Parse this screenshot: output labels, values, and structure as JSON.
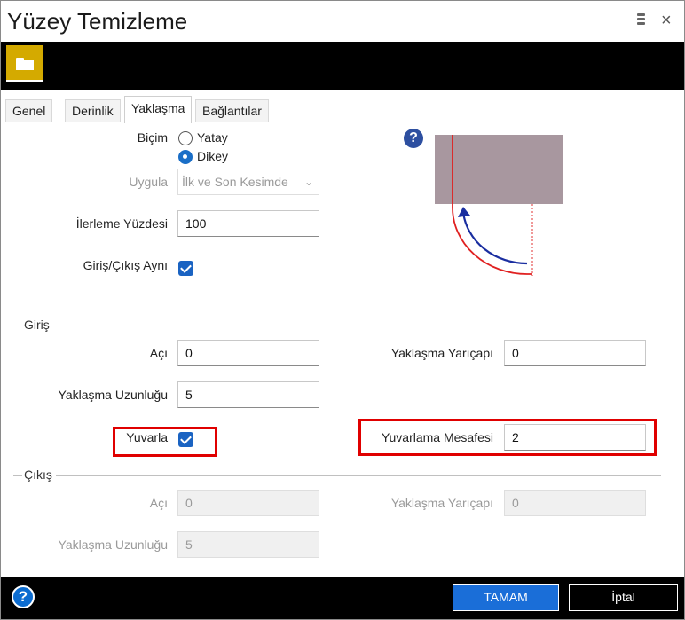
{
  "window": {
    "title": "Yüzey Temizleme",
    "menu_icon": "more-icon",
    "close_icon": "close-icon",
    "close_glyph": "×"
  },
  "toolbar": {
    "icon": "folder-icon",
    "accent": "#d4aa00"
  },
  "tabs": [
    {
      "label": "Genel"
    },
    {
      "label": "Derinlik"
    },
    {
      "label": "Yaklaşma"
    },
    {
      "label": "Bağlantılar"
    }
  ],
  "form": {
    "bicim_label": "Biçim",
    "radio_yatay": "Yatay",
    "radio_dikey": "Dikey",
    "uygula_label": "Uygula",
    "uygula_value": "İlk ve Son Kesimde",
    "ilerleme_label": "İlerleme Yüzdesi",
    "ilerleme_value": "100",
    "giris_cikis_label": "Giriş/Çıkış Aynı"
  },
  "giris": {
    "title": "Giriş",
    "aci_label": "Açı",
    "aci_value": "0",
    "yaklasma_yaricapi_label": "Yaklaşma Yarıçapı",
    "yaklasma_yaricapi_value": "0",
    "yaklasma_uzunlugu_label": "Yaklaşma Uzunluğu",
    "yaklasma_uzunlugu_value": "5",
    "yuvarla_label": "Yuvarla",
    "yuvarlama_mesafesi_label": "Yuvarlama Mesafesi",
    "yuvarlama_mesafesi_value": "2"
  },
  "cikis": {
    "title": "Çıkış",
    "aci_label": "Açı",
    "aci_value": "0",
    "yaklasma_yaricapi_label": "Yaklaşma Yarıçapı",
    "yaklasma_yaricapi_value": "0",
    "yaklasma_uzunlugu_label": "Yaklaşma Uzunluğu",
    "yaklasma_uzunlugu_value": "5"
  },
  "help": {
    "glyph": "?"
  },
  "footer": {
    "ok_label": "TAMAM",
    "cancel_label": "İptal"
  },
  "colors": {
    "accent_blue": "#1a6ed8",
    "highlight_red": "#e00000",
    "preview_block": "#a8979f"
  }
}
